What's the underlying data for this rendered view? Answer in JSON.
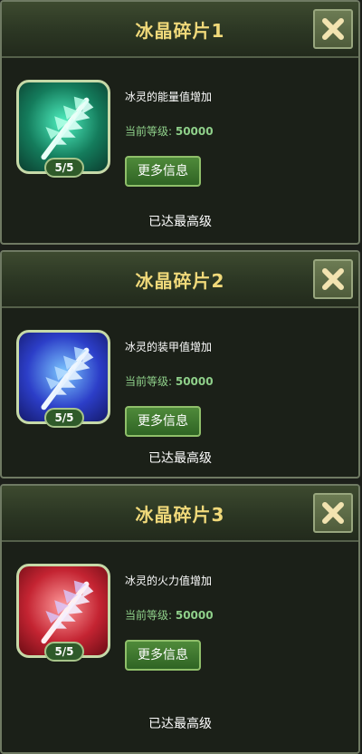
{
  "panels": [
    {
      "title": "冰晶碎片1",
      "description": "冰灵的能量值增加",
      "level_label": "当前等级: ",
      "level_value": "50000",
      "badge": "5/5",
      "button_label": "更多信息",
      "status": "已达最高级",
      "gem_color": "#4ff0c0"
    },
    {
      "title": "冰晶碎片2",
      "description": "冰灵的装甲值增加",
      "level_label": "当前等级: ",
      "level_value": "50000",
      "badge": "5/5",
      "button_label": "更多信息",
      "status": "已达最高级",
      "gem_color": "#7cc8ff"
    },
    {
      "title": "冰晶碎片3",
      "description": "冰灵的火力值增加",
      "level_label": "当前等级: ",
      "level_value": "50000",
      "badge": "5/5",
      "button_label": "更多信息",
      "status": "已达最高级",
      "gem_color": "#ff9c9c"
    }
  ],
  "close_icon": "close-x-icon",
  "accent_colors": {
    "title": "#f0d97a",
    "level": "#8fd08a",
    "button": "#4f8a3a"
  }
}
